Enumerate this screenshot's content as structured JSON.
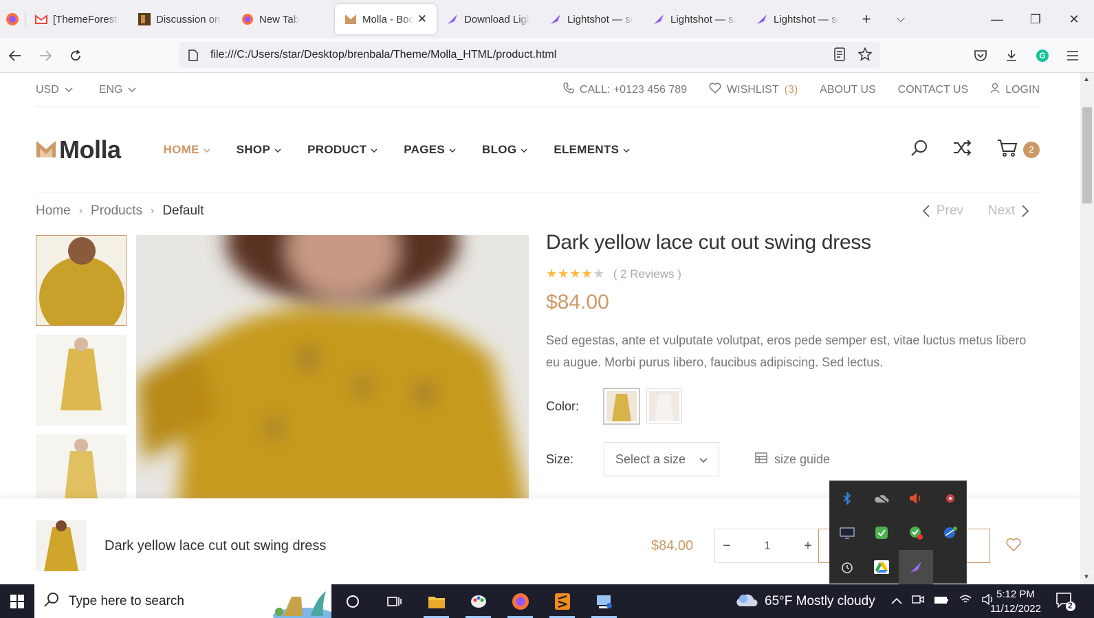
{
  "browser": {
    "tabs": [
      {
        "label": "[ThemeForest]",
        "icon": "gmail-icon"
      },
      {
        "label": "Discussion on T",
        "icon": "themeforest-icon"
      },
      {
        "label": "New Tab",
        "icon": "firefox-icon"
      },
      {
        "label": "Molla - Boo",
        "icon": "molla-icon",
        "active": true
      },
      {
        "label": "Download Ligh",
        "icon": "lightshot-icon"
      },
      {
        "label": "Lightshot — sc",
        "icon": "lightshot-icon"
      },
      {
        "label": "Lightshot — sc",
        "icon": "lightshot-icon"
      },
      {
        "label": "Lightshot — sc",
        "icon": "lightshot-icon"
      }
    ],
    "url": "file:///C:/Users/star/Desktop/brenbala/Theme/Molla_HTML/product.html"
  },
  "topbar": {
    "currency": "USD",
    "language": "ENG",
    "call": "CALL: +0123 456 789",
    "wishlist_label": "WISHLIST",
    "wishlist_count": "(3)",
    "about": "ABOUT US",
    "contact": "CONTACT US",
    "login": "LOGIN"
  },
  "header": {
    "logo_text": "Molla",
    "menu": [
      "HOME",
      "SHOP",
      "PRODUCT",
      "PAGES",
      "BLOG",
      "ELEMENTS"
    ],
    "cart_count": "2"
  },
  "breadcrumb": {
    "home": "Home",
    "products": "Products",
    "current": "Default"
  },
  "pager": {
    "prev": "Prev",
    "next": "Next"
  },
  "product": {
    "title": "Dark yellow lace cut out swing dress",
    "rating": 4,
    "reviews": "( 2 Reviews )",
    "price": "$84.00",
    "description": "Sed egestas, ante et vulputate volutpat, eros pede semper est, vitae luctus metus libero eu augue. Morbi purus libero, faucibus adipiscing. Sed lectus.",
    "color_label": "Color:",
    "size_label": "Size:",
    "size_placeholder": "Select a size",
    "size_guide": "size guide"
  },
  "sticky": {
    "title": "Dark yellow lace cut out swing dress",
    "price": "$84.00",
    "qty_minus": "−",
    "qty": "1",
    "qty_plus": "+"
  },
  "taskbar": {
    "search_placeholder": "Type here to search",
    "weather": "65°F  Mostly cloudy",
    "time": "5:12 PM",
    "date": "11/12/2022",
    "notifications": "2"
  },
  "colors": {
    "accent": "#cc9966",
    "star": "#fcb941",
    "taskbar": "#1c1f2b"
  }
}
